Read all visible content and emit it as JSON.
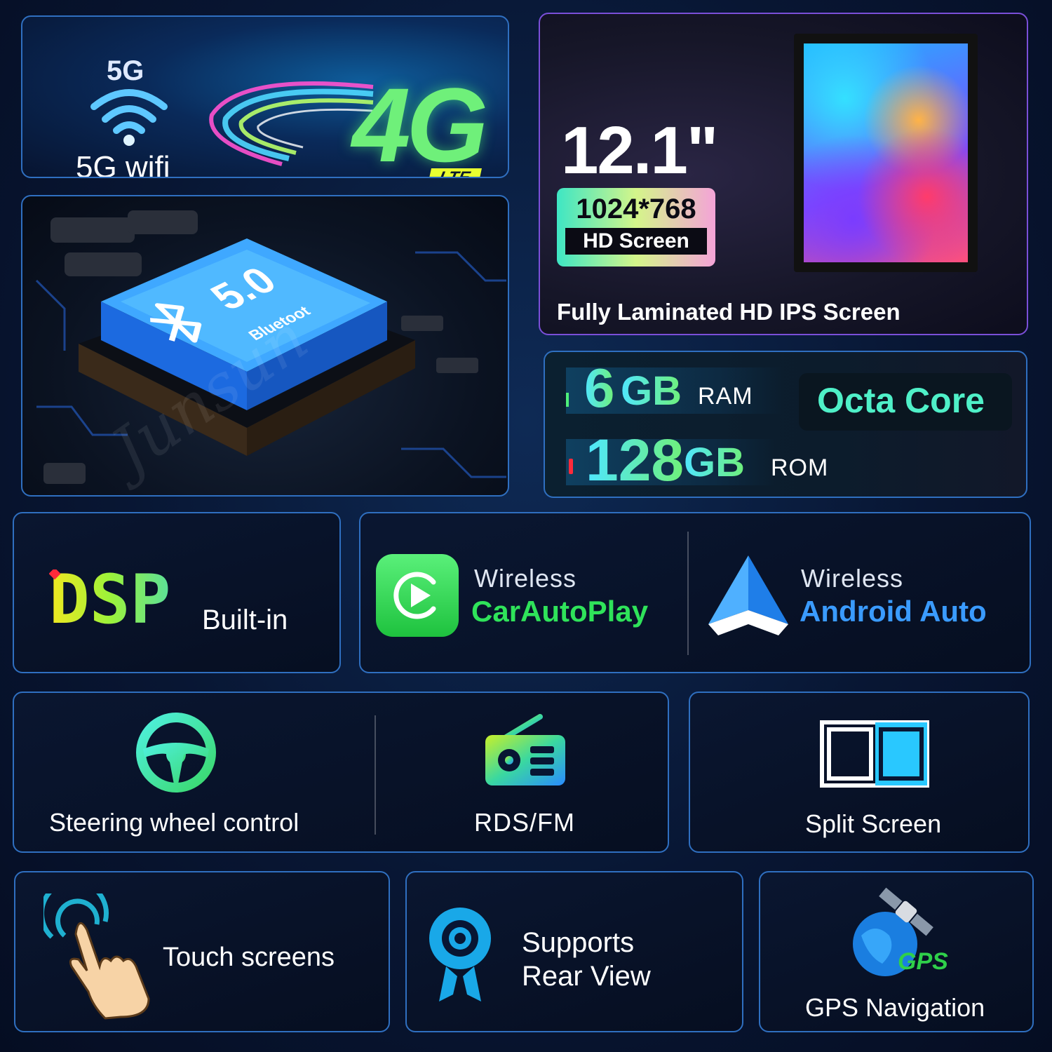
{
  "network": {
    "wifi_badge": "5G",
    "wifi_label": "5G wifi",
    "cellular_big": "4G",
    "cellular_tag": "LTE"
  },
  "bluetooth": {
    "version": "5.0",
    "label": "Bluetoot"
  },
  "screen": {
    "size": "12.1\"",
    "resolution": "1024*768",
    "hd_label": "HD Screen",
    "description": "Fully Laminated HD IPS Screen"
  },
  "memory": {
    "ram_value": "6",
    "ram_unit": "GB",
    "ram_label": "RAM",
    "rom_value": "128",
    "rom_unit": "GB",
    "rom_label": "ROM",
    "cpu": "Octa Core"
  },
  "dsp": {
    "logo": "DSP",
    "label": "Built-in"
  },
  "carplay": {
    "prefix": "Wireless",
    "name": "CarAutoPlay"
  },
  "android_auto": {
    "prefix": "Wireless",
    "name": "Android Auto"
  },
  "features": {
    "steering": "Steering wheel control",
    "radio": "RDS/FM",
    "split": "Split Screen",
    "touch": "Touch screens",
    "rear_line1": "Supports",
    "rear_line2": "Rear View",
    "gps_badge": "GPS",
    "gps": "GPS Navigation"
  },
  "watermark": "Junsun",
  "colors": {
    "accent_green": "#2fe35a",
    "accent_blue": "#3a9bff",
    "accent_teal": "#4ff0c8",
    "card_border": "#2f6fc0"
  },
  "icons": [
    "wifi-icon",
    "bluetooth-icon",
    "chip-icon",
    "tablet-icon",
    "carplay-icon",
    "android-auto-icon",
    "steering-wheel-icon",
    "radio-icon",
    "split-screen-icon",
    "touch-hand-icon",
    "camera-icon",
    "gps-satellite-icon"
  ]
}
